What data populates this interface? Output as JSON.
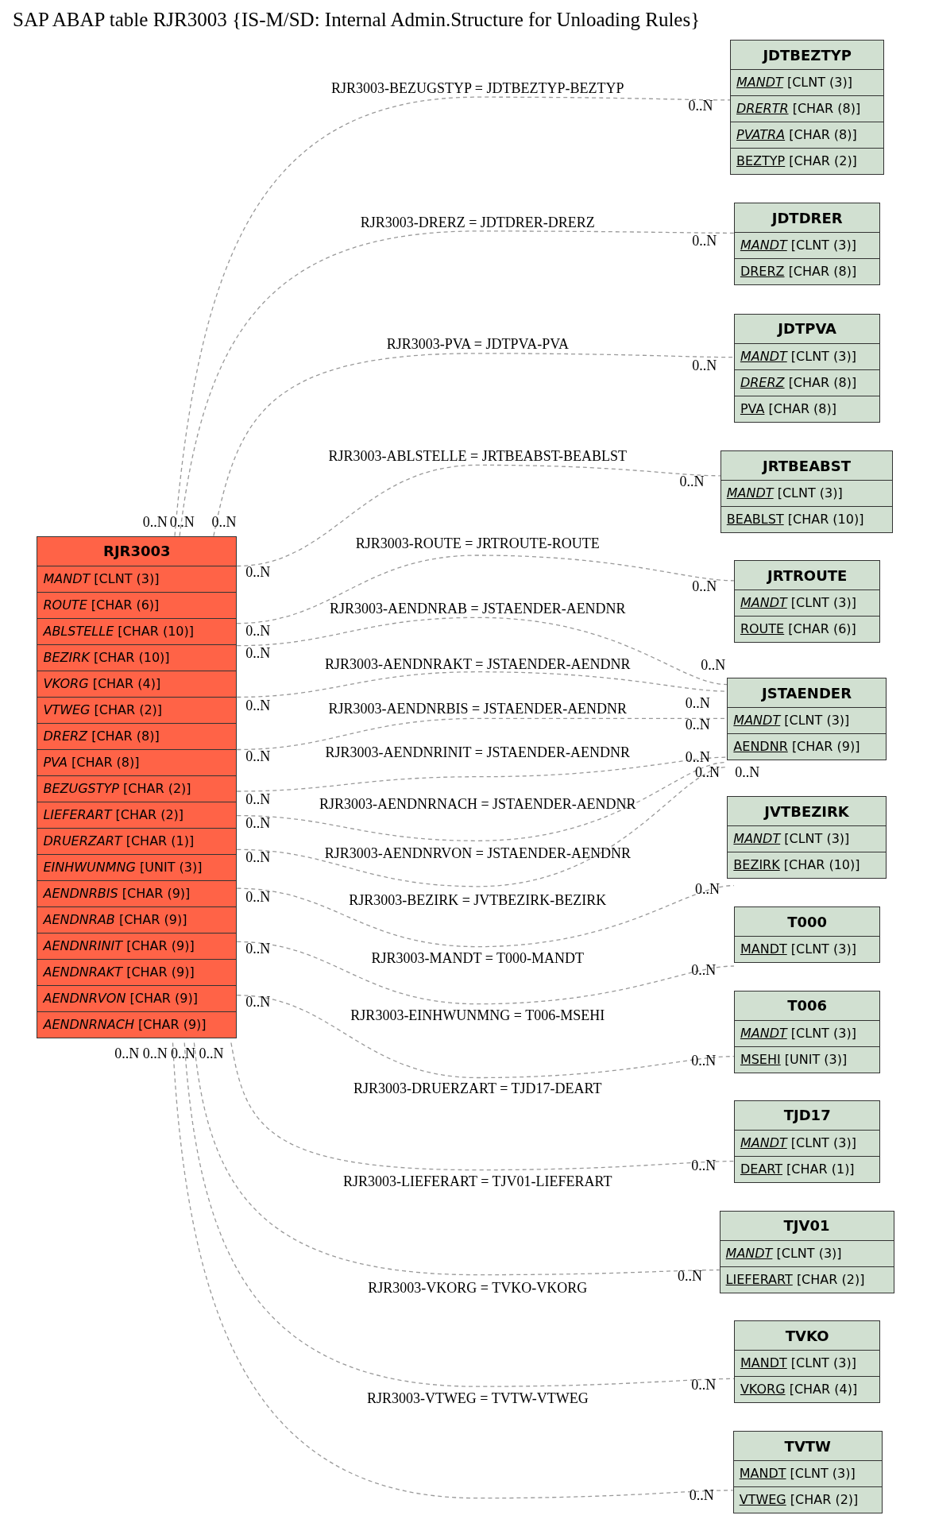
{
  "title": "SAP ABAP table RJR3003 {IS-M/SD: Internal Admin.Structure for Unloading Rules}",
  "main_table": {
    "name": "RJR3003",
    "fields": [
      {
        "name": "MANDT",
        "type": "[CLNT (3)]",
        "key": false,
        "foreign": true
      },
      {
        "name": "ROUTE",
        "type": "[CHAR (6)]",
        "key": false,
        "foreign": true
      },
      {
        "name": "ABLSTELLE",
        "type": "[CHAR (10)]",
        "key": false,
        "foreign": true
      },
      {
        "name": "BEZIRK",
        "type": "[CHAR (10)]",
        "key": false,
        "foreign": true
      },
      {
        "name": "VKORG",
        "type": "[CHAR (4)]",
        "key": false,
        "foreign": true
      },
      {
        "name": "VTWEG",
        "type": "[CHAR (2)]",
        "key": false,
        "foreign": true
      },
      {
        "name": "DRERZ",
        "type": "[CHAR (8)]",
        "key": false,
        "foreign": true
      },
      {
        "name": "PVA",
        "type": "[CHAR (8)]",
        "key": false,
        "foreign": true
      },
      {
        "name": "BEZUGSTYP",
        "type": "[CHAR (2)]",
        "key": false,
        "foreign": true
      },
      {
        "name": "LIEFERART",
        "type": "[CHAR (2)]",
        "key": false,
        "foreign": true
      },
      {
        "name": "DRUERZART",
        "type": "[CHAR (1)]",
        "key": false,
        "foreign": true
      },
      {
        "name": "EINHWUNMNG",
        "type": "[UNIT (3)]",
        "key": false,
        "foreign": true
      },
      {
        "name": "AENDNRBIS",
        "type": "[CHAR (9)]",
        "key": false,
        "foreign": true
      },
      {
        "name": "AENDNRAB",
        "type": "[CHAR (9)]",
        "key": false,
        "foreign": true
      },
      {
        "name": "AENDNRINIT",
        "type": "[CHAR (9)]",
        "key": false,
        "foreign": true
      },
      {
        "name": "AENDNRAKT",
        "type": "[CHAR (9)]",
        "key": false,
        "foreign": true
      },
      {
        "name": "AENDNRVON",
        "type": "[CHAR (9)]",
        "key": false,
        "foreign": true
      },
      {
        "name": "AENDNRNACH",
        "type": "[CHAR (9)]",
        "key": false,
        "foreign": true
      }
    ]
  },
  "tables": [
    {
      "name": "JDTBEZTYP",
      "fields": [
        {
          "name": "MANDT",
          "type": "[CLNT (3)]",
          "key": true,
          "foreign": true
        },
        {
          "name": "DRERTR",
          "type": "[CHAR (8)]",
          "key": true,
          "foreign": true
        },
        {
          "name": "PVATRA",
          "type": "[CHAR (8)]",
          "key": true,
          "foreign": true
        },
        {
          "name": "BEZTYP",
          "type": "[CHAR (2)]",
          "key": true,
          "foreign": false
        }
      ]
    },
    {
      "name": "JDTDRER",
      "fields": [
        {
          "name": "MANDT",
          "type": "[CLNT (3)]",
          "key": true,
          "foreign": true
        },
        {
          "name": "DRERZ",
          "type": "[CHAR (8)]",
          "key": true,
          "foreign": false
        }
      ]
    },
    {
      "name": "JDTPVA",
      "fields": [
        {
          "name": "MANDT",
          "type": "[CLNT (3)]",
          "key": true,
          "foreign": true
        },
        {
          "name": "DRERZ",
          "type": "[CHAR (8)]",
          "key": true,
          "foreign": true
        },
        {
          "name": "PVA",
          "type": "[CHAR (8)]",
          "key": true,
          "foreign": false
        }
      ]
    },
    {
      "name": "JRTBEABST",
      "fields": [
        {
          "name": "MANDT",
          "type": "[CLNT (3)]",
          "key": true,
          "foreign": true
        },
        {
          "name": "BEABLST",
          "type": "[CHAR (10)]",
          "key": true,
          "foreign": false
        }
      ]
    },
    {
      "name": "JRTROUTE",
      "fields": [
        {
          "name": "MANDT",
          "type": "[CLNT (3)]",
          "key": true,
          "foreign": true
        },
        {
          "name": "ROUTE",
          "type": "[CHAR (6)]",
          "key": true,
          "foreign": false
        }
      ]
    },
    {
      "name": "JSTAENDER",
      "fields": [
        {
          "name": "MANDT",
          "type": "[CLNT (3)]",
          "key": true,
          "foreign": true
        },
        {
          "name": "AENDNR",
          "type": "[CHAR (9)]",
          "key": true,
          "foreign": false
        }
      ]
    },
    {
      "name": "JVTBEZIRK",
      "fields": [
        {
          "name": "MANDT",
          "type": "[CLNT (3)]",
          "key": true,
          "foreign": true
        },
        {
          "name": "BEZIRK",
          "type": "[CHAR (10)]",
          "key": true,
          "foreign": false
        }
      ]
    },
    {
      "name": "T000",
      "fields": [
        {
          "name": "MANDT",
          "type": "[CLNT (3)]",
          "key": true,
          "foreign": false
        }
      ]
    },
    {
      "name": "T006",
      "fields": [
        {
          "name": "MANDT",
          "type": "[CLNT (3)]",
          "key": true,
          "foreign": true
        },
        {
          "name": "MSEHI",
          "type": "[UNIT (3)]",
          "key": true,
          "foreign": false
        }
      ]
    },
    {
      "name": "TJD17",
      "fields": [
        {
          "name": "MANDT",
          "type": "[CLNT (3)]",
          "key": true,
          "foreign": true
        },
        {
          "name": "DEART",
          "type": "[CHAR (1)]",
          "key": true,
          "foreign": false
        }
      ]
    },
    {
      "name": "TJV01",
      "fields": [
        {
          "name": "MANDT",
          "type": "[CLNT (3)]",
          "key": true,
          "foreign": true
        },
        {
          "name": "LIEFERART",
          "type": "[CHAR (2)]",
          "key": true,
          "foreign": false
        }
      ]
    },
    {
      "name": "TVKO",
      "fields": [
        {
          "name": "MANDT",
          "type": "[CLNT (3)]",
          "key": true,
          "foreign": false
        },
        {
          "name": "VKORG",
          "type": "[CHAR (4)]",
          "key": true,
          "foreign": false
        }
      ]
    },
    {
      "name": "TVTW",
      "fields": [
        {
          "name": "MANDT",
          "type": "[CLNT (3)]",
          "key": true,
          "foreign": false
        },
        {
          "name": "VTWEG",
          "type": "[CHAR (2)]",
          "key": true,
          "foreign": false
        }
      ]
    }
  ],
  "relations": [
    {
      "label": "RJR3003-BEZUGSTYP = JDTBEZTYP-BEZTYP",
      "from_cardinality": "0..N",
      "to_cardinality": "0..N"
    },
    {
      "label": "RJR3003-DRERZ = JDTDRER-DRERZ",
      "from_cardinality": "0..N",
      "to_cardinality": "0..N"
    },
    {
      "label": "RJR3003-PVA = JDTPVA-PVA",
      "from_cardinality": "0..N",
      "to_cardinality": "0..N"
    },
    {
      "label": "RJR3003-ABLSTELLE = JRTBEABST-BEABLST",
      "from_cardinality": "0..N",
      "to_cardinality": "0..N"
    },
    {
      "label": "RJR3003-ROUTE = JRTROUTE-ROUTE",
      "from_cardinality": "0..N",
      "to_cardinality": "0..N"
    },
    {
      "label": "RJR3003-AENDNRAB = JSTAENDER-AENDNR",
      "from_cardinality": "0..N",
      "to_cardinality": "0..N"
    },
    {
      "label": "RJR3003-AENDNRAKT = JSTAENDER-AENDNR",
      "from_cardinality": "0..N",
      "to_cardinality": "0..N"
    },
    {
      "label": "RJR3003-AENDNRBIS = JSTAENDER-AENDNR",
      "from_cardinality": "0..N",
      "to_cardinality": "0..N"
    },
    {
      "label": "RJR3003-AENDNRINIT = JSTAENDER-AENDNR",
      "from_cardinality": "0..N",
      "to_cardinality": "0..N"
    },
    {
      "label": "RJR3003-AENDNRNACH = JSTAENDER-AENDNR",
      "from_cardinality": "0..N",
      "to_cardinality": "0..N"
    },
    {
      "label": "RJR3003-AENDNRVON = JSTAENDER-AENDNR",
      "from_cardinality": "0..N",
      "to_cardinality": "0..N"
    },
    {
      "label": "RJR3003-BEZIRK = JVTBEZIRK-BEZIRK",
      "from_cardinality": "0..N",
      "to_cardinality": "0..N"
    },
    {
      "label": "RJR3003-MANDT = T000-MANDT",
      "from_cardinality": "0..N",
      "to_cardinality": "0..N"
    },
    {
      "label": "RJR3003-EINHWUNMNG = T006-MSEHI",
      "from_cardinality": "0..N",
      "to_cardinality": "0..N"
    },
    {
      "label": "RJR3003-DRUERZART = TJD17-DEART",
      "from_cardinality": "0..N",
      "to_cardinality": "0..N"
    },
    {
      "label": "RJR3003-LIEFERART = TJV01-LIEFERART",
      "from_cardinality": "0..N",
      "to_cardinality": "0..N"
    },
    {
      "label": "RJR3003-VKORG = TVKO-VKORG",
      "from_cardinality": "0..N",
      "to_cardinality": "0..N"
    },
    {
      "label": "RJR3003-VTWEG = TVTW-VTWEG",
      "from_cardinality": "0..N",
      "to_cardinality": "0..N"
    }
  ]
}
